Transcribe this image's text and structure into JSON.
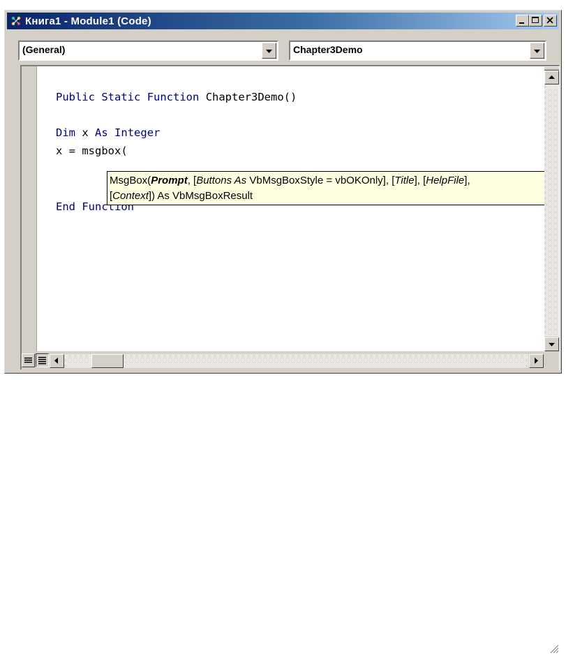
{
  "window": {
    "title": "Книга1 - Module1 (Code)",
    "icon": "vba-module-icon"
  },
  "caption_buttons": [
    "minimize-icon",
    "maximize-icon",
    "close-icon"
  ],
  "object_combo": {
    "value": "(General)"
  },
  "procedure_combo": {
    "value": "Chapter3Demo"
  },
  "code": {
    "line1_kw1": "Public",
    "line1_kw2": "Static",
    "line1_kw3": "Function",
    "line1_rest": "Chapter3Demo()",
    "line2_kw1": "Dim",
    "line2_mid": "x",
    "line2_kw2": "As",
    "line2_kw3": "Integer",
    "line3": "x = msgbox(",
    "line4_kw1": "End",
    "line4_kw2": "Function"
  },
  "tooltip": {
    "func": "MsgBox(",
    "prompt": "Prompt",
    "sep1": ", [",
    "buttons": "Buttons As",
    "type1": " VbMsgBoxStyle = vbOKOnly], [",
    "title": "Title",
    "sep2": "], [",
    "helpfile": "HelpFile",
    "sep3": "],",
    "open": "[",
    "context": "Context",
    "returns": "]) As VbMsgBoxResult"
  },
  "colors": {
    "keyword": "#00007f",
    "title_bar_start": "#0a246a",
    "title_bar_end": "#a6caf0",
    "tooltip_bg": "#ffffe1"
  }
}
